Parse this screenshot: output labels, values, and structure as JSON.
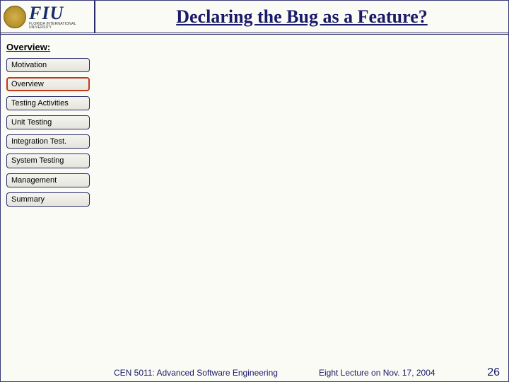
{
  "header": {
    "logo_text": "FIU",
    "logo_subtext": "FLORIDA INTERNATIONAL UNIVERSITY",
    "title": "Declaring the Bug as a Feature?"
  },
  "sidebar": {
    "section_label": "Overview:",
    "items": [
      {
        "label": "Motivation",
        "active": false
      },
      {
        "label": "Overview",
        "active": true
      },
      {
        "label": "Testing Activities",
        "active": false
      },
      {
        "label": "Unit Testing",
        "active": false
      },
      {
        "label": "Integration Test.",
        "active": false
      },
      {
        "label": "System Testing",
        "active": false
      },
      {
        "label": "Management",
        "active": false
      },
      {
        "label": "Summary",
        "active": false
      }
    ]
  },
  "footer": {
    "course": "CEN 5011: Advanced Software Engineering",
    "lecture": "Eight Lecture on Nov. 17, 2004",
    "page": "26"
  }
}
